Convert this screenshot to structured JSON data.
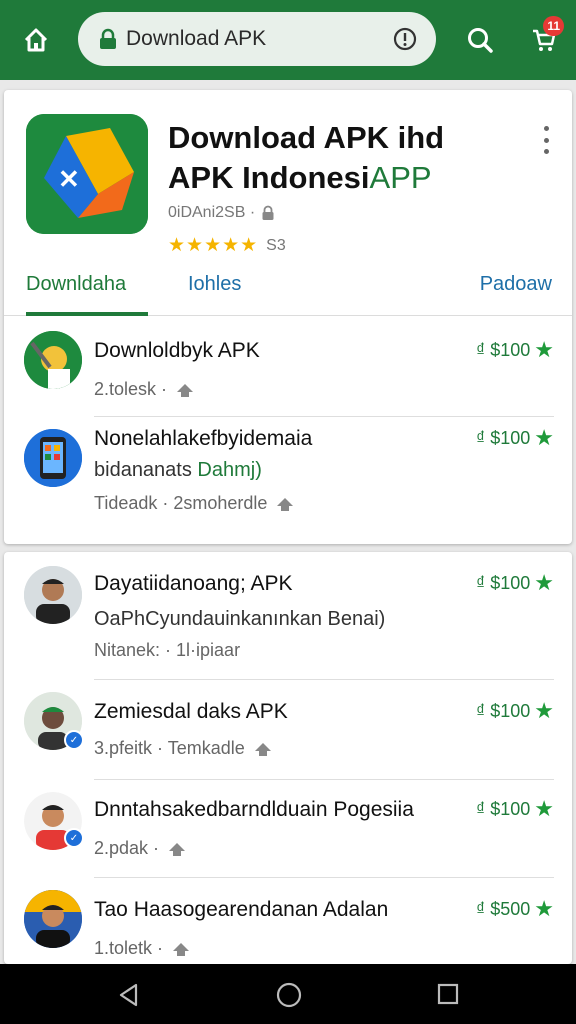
{
  "browser": {
    "url_text": "Download APK",
    "cart_badge": "11"
  },
  "app": {
    "title_line1": "Download APK  ihd",
    "title_line2_main": "APK Indonesi",
    "title_line2_accent": "APP",
    "meta": "0iDAni2SB ·",
    "stars": "★★★★★",
    "rating_count": "S3"
  },
  "tabs": [
    {
      "label": "Downldaha"
    },
    {
      "label": "Iohles"
    },
    {
      "label": "Padoaw"
    }
  ],
  "list1": [
    {
      "title": "Downloldbyk APK",
      "sub": "",
      "meta": "2.tolesk ·",
      "price": "₫ $100"
    },
    {
      "title": "Nonelahlakefbyidemaia",
      "sub_main": "bidananats ",
      "sub_accent": "Dahmj)",
      "meta": "Tideadk · 2smoherdle",
      "price": "₫ $100"
    }
  ],
  "list2": [
    {
      "title": "Dayatiidanoang; APK",
      "sub": "OaPhCyundauinkanınkan Benai)",
      "meta": "Nitanek: · 1l·ipiaar",
      "price": "₫ $100"
    },
    {
      "title": "Zemiesdal daks APK",
      "meta": "3.pfeitk · Temkadle",
      "price": "₫ $100"
    },
    {
      "title": "Dnntahsakedbarndlduain Pogesiia",
      "meta": "2.pdak ·",
      "price": "₫ $100"
    },
    {
      "title": "Tao Haasogearendanan Adalan",
      "meta": "1.toletk ·",
      "price": "₫ $500"
    }
  ],
  "colors": {
    "brand_green": "#1f7a3a",
    "link_blue": "#1e6fa8",
    "star_gold": "#f5b400"
  }
}
